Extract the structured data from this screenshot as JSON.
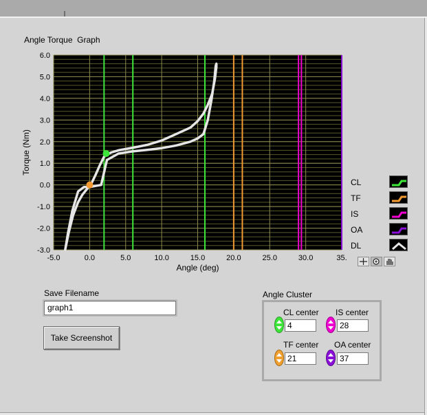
{
  "graph": {
    "title": "Angle Torque  Graph",
    "x_axis_label": "Angle (deg)",
    "y_axis_label": "Torque (Nm)",
    "x_ticks": [
      "-5.0",
      "0.0",
      "5.0",
      "10.0",
      "15.0",
      "20.0",
      "25.0",
      "30.0",
      "35."
    ],
    "y_ticks": [
      "6.0",
      "5.0",
      "4.0",
      "3.0",
      "2.0",
      "1.0",
      "0.0",
      "-1.0",
      "-2.0",
      "-3.0"
    ],
    "colors": {
      "plot_bg": "#000000",
      "grid_major": "#8c8a4e",
      "grid_minor": "#5a5a2c",
      "CL": "#3ee63a",
      "TF": "#f39a32",
      "IS": "#f000d0",
      "OA": "#8a10d8",
      "DL": "#e6e6e6"
    }
  },
  "chart_data": {
    "type": "line",
    "title": "Angle Torque  Graph",
    "xlabel": "Angle (deg)",
    "ylabel": "Torque (Nm)",
    "xlim": [
      -5,
      35
    ],
    "ylim": [
      -3,
      6
    ],
    "grid": true,
    "legend_position": "right",
    "vertical_markers": [
      {
        "name": "CL",
        "x": [
          2,
          6
        ]
      },
      {
        "name": "CL",
        "x": [
          16
        ]
      },
      {
        "name": "TF",
        "x": [
          20,
          21.2
        ]
      },
      {
        "name": "IS",
        "x": [
          29,
          29.4
        ]
      },
      {
        "name": "OA",
        "x": [
          35
        ]
      }
    ],
    "series": [
      {
        "name": "DL",
        "x": [
          -3.4,
          -3,
          -2.4,
          -1.6,
          -0.8,
          0,
          0.8,
          1.6,
          2.4,
          4,
          6,
          8,
          10,
          12,
          14,
          15,
          15.8,
          16.4,
          16.9,
          17.3,
          17.5,
          17.6,
          17.6,
          17.4,
          17,
          16.4,
          15.8,
          15,
          14,
          12,
          10,
          8,
          6,
          4,
          3,
          2.4,
          2,
          1.4,
          0.8,
          0.3,
          0,
          -0.4,
          -1,
          -1.6,
          -2.3,
          -2.9,
          -3.4
        ],
        "y": [
          -3,
          -2.2,
          -1.2,
          -0.3,
          -0.1,
          -0.1,
          -0.05,
          0,
          1.15,
          1.45,
          1.55,
          1.62,
          1.7,
          1.82,
          2,
          2.15,
          2.35,
          3,
          3.9,
          4.8,
          5.5,
          5.6,
          5.45,
          4.9,
          4.2,
          3.7,
          3.3,
          2.95,
          2.65,
          2.35,
          2.05,
          1.85,
          1.72,
          1.6,
          1.5,
          1.4,
          1.3,
          0.9,
          0.45,
          0.1,
          -0.05,
          -0.2,
          -0.45,
          -0.8,
          -1.4,
          -2.2,
          -3
        ]
      }
    ],
    "points": [
      {
        "name": "CL",
        "x": 2.3,
        "y": 1.45
      },
      {
        "name": "TF",
        "x": 0,
        "y": 0
      }
    ]
  },
  "legend": [
    {
      "label": "CL",
      "color": "#3ee63a",
      "icon": "line-icon"
    },
    {
      "label": "TF",
      "color": "#f39a32",
      "icon": "line-icon"
    },
    {
      "label": "IS",
      "color": "#f000d0",
      "icon": "line-icon"
    },
    {
      "label": "OA",
      "color": "#8a10d8",
      "icon": "line-icon"
    },
    {
      "label": "DL",
      "color": "#e6e6e6",
      "icon": "caret-line-icon"
    }
  ],
  "graph_palette": {
    "cursor_tool": "crosshair-icon",
    "zoom_tool": "zoom-icon",
    "pan_tool": "hand-icon"
  },
  "save": {
    "label": "Save Filename",
    "value": "graph1"
  },
  "screenshot_button": {
    "label": "Take Screenshot"
  },
  "angle_cluster": {
    "title": "Angle Cluster",
    "cl": {
      "label": "CL center",
      "value": "4",
      "color": "#3ee63a"
    },
    "is": {
      "label": "IS center",
      "value": "28",
      "color": "#f000d0"
    },
    "tf": {
      "label": "TF center",
      "value": "21",
      "color": "#f0a030"
    },
    "oa": {
      "label": "OA center",
      "value": "37",
      "color": "#8a10d8"
    }
  }
}
